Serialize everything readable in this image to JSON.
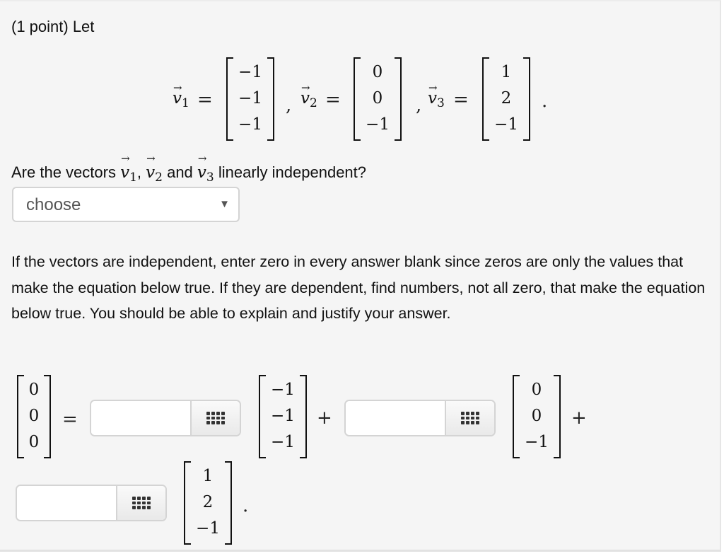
{
  "problem": {
    "header": "(1 point) Let",
    "vectors": [
      {
        "name": "v",
        "sub": "1",
        "arrow": "→",
        "entries": [
          "−1",
          "−1",
          "−1"
        ]
      },
      {
        "name": "v",
        "sub": "2",
        "arrow": "→",
        "entries": [
          "0",
          "0",
          "−1"
        ]
      },
      {
        "name": "v",
        "sub": "3",
        "arrow": "→",
        "entries": [
          "1",
          "2",
          "−1"
        ]
      }
    ],
    "symbols": {
      "equals": "=",
      "comma": ",",
      "period": ".",
      "plus": "+"
    },
    "question": {
      "prefix": "Are the vectors ",
      "sep1": ", ",
      "and": " and ",
      "suffix": " linearly independent?"
    },
    "dropdown": {
      "selected": "choose",
      "caret": "▼"
    },
    "instructions": "If the vectors are independent, enter zero in every answer blank since zeros are only the values that make the equation below true. If they are dependent, find numbers, not all zero, that make the equation below true. You should be able to explain and justify your answer.",
    "equation": {
      "zero_vector": [
        "0",
        "0",
        "0"
      ],
      "answers": [
        {
          "value": "",
          "button_icon": "grid-icon"
        },
        {
          "value": "",
          "button_icon": "grid-icon"
        },
        {
          "value": "",
          "button_icon": "grid-icon"
        }
      ]
    }
  }
}
